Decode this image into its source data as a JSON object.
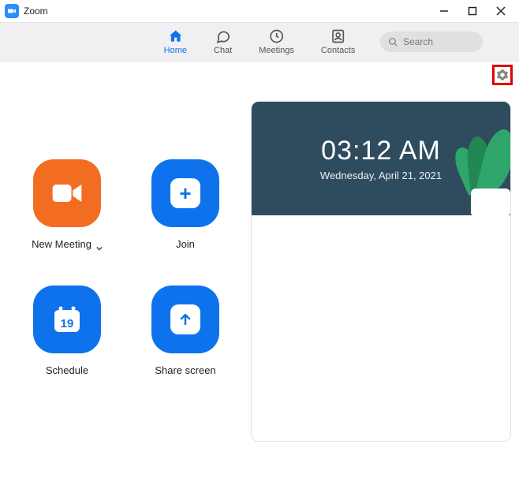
{
  "titlebar": {
    "app_name": "Zoom"
  },
  "nav": {
    "tabs": [
      {
        "label": "Home"
      },
      {
        "label": "Chat"
      },
      {
        "label": "Meetings"
      },
      {
        "label": "Contacts"
      }
    ],
    "search_placeholder": "Search"
  },
  "actions": {
    "new_meeting": "New Meeting",
    "join": "Join",
    "schedule": "Schedule",
    "schedule_day": "19",
    "share_screen": "Share screen"
  },
  "clock": {
    "time": "03:12 AM",
    "date": "Wednesday, April 21, 2021"
  }
}
